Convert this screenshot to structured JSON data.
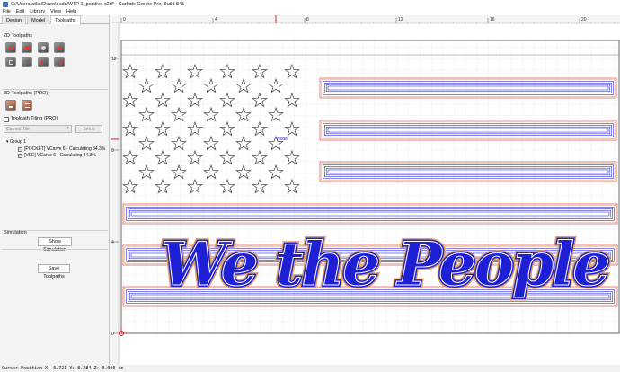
{
  "window": {
    "title": "C:/Users/wilia/Downloads/WTP 1_positive.c2d* - Carbide Create Pro, Build 845"
  },
  "menu": [
    "File",
    "Edit",
    "Library",
    "View",
    "Help"
  ],
  "sidebar": {
    "tabs": [
      "Design",
      "Model",
      "Toolpaths"
    ],
    "active_tab": "Toolpaths",
    "toolpaths_2d_label": "2D Toolpaths",
    "toolpaths_3d_label": "3D Toolpaths (PRO)",
    "tiling_label": "Toolpath Tiling (PRO)",
    "tile_select": "Current Tile",
    "setup_label": "Setup",
    "tree": {
      "group": "Group 1",
      "items": [
        "[POCKET] VCarve 6 - Calculating 34.3%",
        "[VEE] VCarve 6 - Calculating 34.3%"
      ]
    },
    "simulation_label": "Simulation",
    "show_simulation": "Show Simulation",
    "save_toolpaths": "Save Toolpaths"
  },
  "ruler": {
    "top_ticks": [
      "0",
      "4",
      "8",
      "12",
      "16",
      "20"
    ],
    "left_ticks": [
      "0",
      "4",
      "8",
      "12"
    ]
  },
  "canvas": {
    "text_art": "We the People",
    "node_label": "Node",
    "accent_color": "#1f1fd6",
    "offset_color": "#e0a060",
    "origin_color": "#d22222"
  },
  "status": {
    "cursor": "Cursor Position X: 6.721 Y: 8.284 Z: 0.000 in"
  }
}
